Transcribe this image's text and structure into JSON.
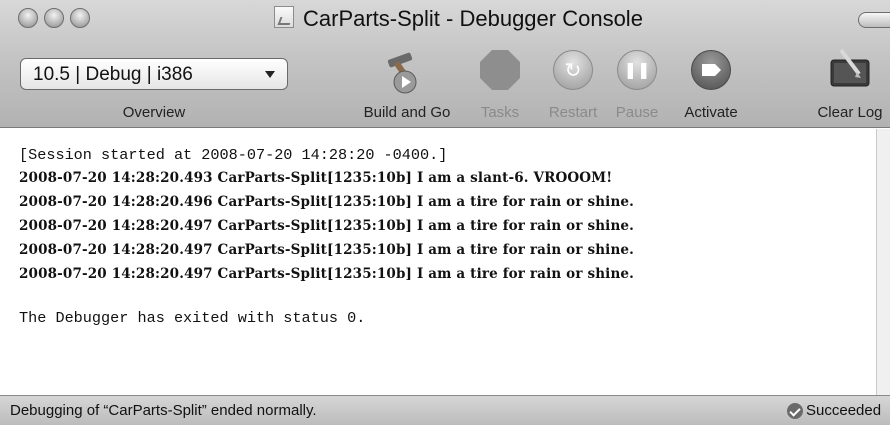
{
  "window": {
    "title": "CarParts-Split - Debugger Console"
  },
  "toolbar": {
    "overview_value": "10.5 | Debug | i386",
    "overview_label": "Overview",
    "items": [
      {
        "label": "Build and Go",
        "icon": "hammer-play-icon",
        "enabled": true
      },
      {
        "label": "Tasks",
        "icon": "stop-icon",
        "enabled": false
      },
      {
        "label": "Restart",
        "icon": "restart-icon",
        "enabled": false
      },
      {
        "label": "Pause",
        "icon": "pause-icon",
        "enabled": false
      },
      {
        "label": "Activate",
        "icon": "activate-icon",
        "enabled": true
      },
      {
        "label": "Clear Log",
        "icon": "clear-log-icon",
        "enabled": true
      }
    ]
  },
  "console": {
    "lines": [
      {
        "text": "[Session started at 2008-07-20 14:28:20 -0400.]",
        "bold": false
      },
      {
        "text": "2008-07-20 14:28:20.493 CarParts-Split[1235:10b] I am a slant-6. VROOOM!",
        "bold": true
      },
      {
        "text": "2008-07-20 14:28:20.496 CarParts-Split[1235:10b] I am a tire for rain or shine.",
        "bold": true
      },
      {
        "text": "2008-07-20 14:28:20.497 CarParts-Split[1235:10b] I am a tire for rain or shine.",
        "bold": true
      },
      {
        "text": "2008-07-20 14:28:20.497 CarParts-Split[1235:10b] I am a tire for rain or shine.",
        "bold": true
      },
      {
        "text": "2008-07-20 14:28:20.497 CarParts-Split[1235:10b] I am a tire for rain or shine.",
        "bold": true
      },
      {
        "text": "",
        "bold": false
      },
      {
        "text": "The Debugger has exited with status 0.",
        "bold": false
      }
    ]
  },
  "status": {
    "message": "Debugging of “CarParts-Split” ended normally.",
    "result": "Succeeded",
    "result_icon": "check-circle-icon"
  },
  "colors": {
    "chrome_gray": "#c4c4c4",
    "console_background": "#ffffff",
    "text": "#111111",
    "disabled_text": "#8a8a8a"
  }
}
